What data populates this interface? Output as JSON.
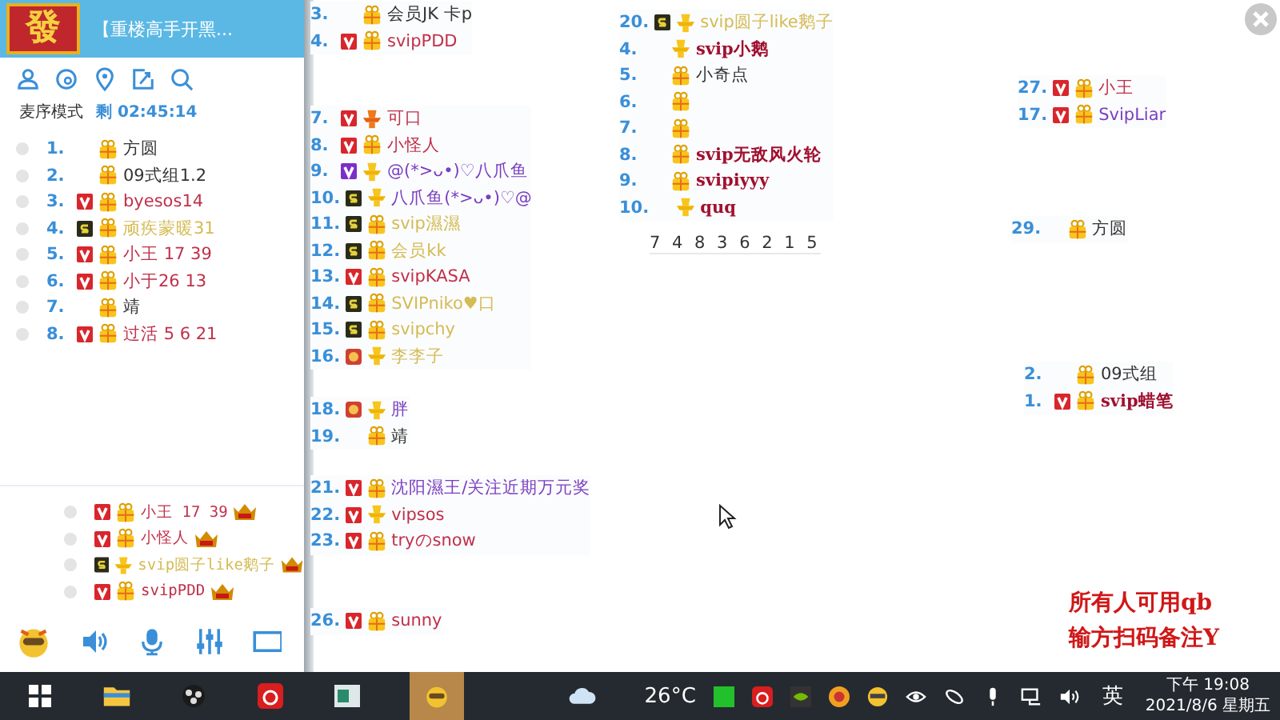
{
  "sidebar": {
    "logo": "發",
    "title": "【重楼高手开黑...",
    "mode": "麦序模式",
    "timer": "剩 02:45:14",
    "queue": [
      {
        "num": "1.",
        "kind": "plain-gift",
        "name": "方圆",
        "color": "#333333"
      },
      {
        "num": "2.",
        "kind": "plain-gift",
        "name": "09式组1.2",
        "color": "#333333"
      },
      {
        "num": "3.",
        "kind": "vip-gift",
        "name": "byesos14",
        "color": "#c0304a"
      },
      {
        "num": "4.",
        "kind": "member-gift",
        "name": "顽疾蒙暖31",
        "color": "#d4bb55"
      },
      {
        "num": "5.",
        "kind": "vip-gift",
        "name": "小王 17 39",
        "color": "#c0304a"
      },
      {
        "num": "6.",
        "kind": "vip-gift",
        "name": "小于26 13",
        "color": "#c0304a"
      },
      {
        "num": "7.",
        "kind": "plain-gift",
        "name": "靖",
        "color": "#333333"
      },
      {
        "num": "8.",
        "kind": "vip-gift",
        "name": "过活 5 6 21",
        "color": "#c0304a"
      }
    ],
    "mic_list": [
      {
        "kind": "vip-gift",
        "name": "小王 17 39",
        "color": "#c0304a"
      },
      {
        "kind": "vip-gift",
        "name": "小怪人",
        "color": "#c0304a"
      },
      {
        "kind": "member-trophy",
        "name": "svip圆子like鹅子",
        "color": "#d4bb55"
      },
      {
        "kind": "vip-gift",
        "name": "svipPDD",
        "color": "#c0304a"
      }
    ]
  },
  "groups": [
    {
      "rows": [
        {
          "num": "3.",
          "kind": "plain-gift",
          "name": "会员JK 卡p",
          "color": "#333333",
          "bold": false
        },
        {
          "num": "4.",
          "kind": "vip-gift",
          "name": "svipPDD",
          "color": "#c0304a",
          "bold": false
        }
      ]
    },
    {
      "rows": [
        {
          "num": "7.",
          "kind": "vip-orange",
          "name": "可口",
          "color": "#c0304a",
          "bold": false
        },
        {
          "num": "8.",
          "kind": "vip-gift",
          "name": "小怪人",
          "color": "#c0304a",
          "bold": false
        },
        {
          "num": "9.",
          "kind": "purple-trophy",
          "name": "@(*>ᴗ•)♡八爪鱼",
          "color": "#7a3fc0",
          "bold": false
        },
        {
          "num": "10.",
          "kind": "member-trophy",
          "name": "八爪鱼(*>ᴗ•)♡@",
          "color": "#7a3fc0",
          "bold": false
        },
        {
          "num": "11.",
          "kind": "member-gift",
          "name": "svip濕濕",
          "color": "#d4bb55",
          "bold": false
        },
        {
          "num": "12.",
          "kind": "member-gift",
          "name": "会员kk",
          "color": "#d4bb55",
          "bold": false
        },
        {
          "num": "13.",
          "kind": "vip-gift",
          "name": "svipKASA",
          "color": "#c0304a",
          "bold": false
        },
        {
          "num": "14.",
          "kind": "member-gift",
          "name": "SVIPniko♥口",
          "color": "#d4bb55",
          "bold": false
        },
        {
          "num": "15.",
          "kind": "member-gift",
          "name": "svipchy",
          "color": "#d4bb55",
          "bold": false
        },
        {
          "num": "16.",
          "kind": "face-trophy",
          "name": "李李子",
          "color": "#d4bb55",
          "bold": false
        }
      ]
    },
    {
      "rows": [
        {
          "num": "18.",
          "kind": "face-trophy",
          "name": "胖",
          "color": "#7a3fc0",
          "bold": false
        },
        {
          "num": "19.",
          "kind": "plain-gift",
          "name": "靖",
          "color": "#333333",
          "bold": false
        }
      ]
    },
    {
      "rows": [
        {
          "num": "21.",
          "kind": "vip-gift",
          "name": "沈阳濕王/关注近期万元奖",
          "color": "#7a3fc0",
          "bold": false
        },
        {
          "num": "22.",
          "kind": "vip-trophy",
          "name": "vipsos",
          "color": "#c0304a",
          "bold": false
        },
        {
          "num": "23.",
          "kind": "vip-gift",
          "name": "tryのsnow",
          "color": "#c0304a",
          "bold": false
        }
      ]
    },
    {
      "rows": [
        {
          "num": "26.",
          "kind": "vip-gift",
          "name": "sunny",
          "color": "#c0304a",
          "bold": false
        }
      ]
    },
    {
      "rows": [
        {
          "num": "20.",
          "kind": "member-trophy",
          "name": "svip圆子like鹅子",
          "color": "#d4bb55",
          "bold": false
        },
        {
          "num": "4.",
          "kind": "plain-trophy",
          "name": "svip小鹅",
          "color": "#a01030",
          "bold": true
        },
        {
          "num": "5.",
          "kind": "plain-gift",
          "name": "小奇点",
          "color": "#333333",
          "bold": false
        },
        {
          "num": "6.",
          "kind": "plain-gift"
        },
        {
          "num": "7.",
          "kind": "plain-gift"
        },
        {
          "num": "8.",
          "kind": "plain-gift",
          "name": "svip无敌风火轮",
          "color": "#a01030",
          "bold": true
        },
        {
          "num": "9.",
          "kind": "plain-gift",
          "name": "svipiyyy",
          "color": "#a01030",
          "bold": true
        },
        {
          "num": "10.",
          "kind": "plain-trophy",
          "name": "quq",
          "color": "#a01030",
          "bold": true
        }
      ]
    },
    {
      "rows": [
        {
          "num": "27.",
          "kind": "vip-gift",
          "name": "小王",
          "color": "#c0304a",
          "bold": false
        },
        {
          "num": "17.",
          "kind": "vip-gift",
          "name": "SvipLiar",
          "color": "#7a3fc0",
          "bold": false
        }
      ]
    },
    {
      "rows": [
        {
          "num": "29.",
          "kind": "plain-gift",
          "name": "方圆",
          "color": "#333333",
          "bold": false
        }
      ]
    },
    {
      "rows": [
        {
          "num": "2.",
          "kind": "plain-gift",
          "name": "09式组",
          "color": "#333333",
          "bold": false
        },
        {
          "num": "1.",
          "kind": "vip-gift",
          "name": "svip蜡笔",
          "color": "#a01030",
          "bold": true
        }
      ]
    }
  ],
  "digits": "7 4 8 3 6 2 1 5",
  "notice": [
    "所有人可用qb",
    "输方扫码备注Y"
  ],
  "taskbar": {
    "weather": "26°C",
    "ime": "英",
    "time": "下午 19:08",
    "date": "2021/8/6 星期五"
  }
}
